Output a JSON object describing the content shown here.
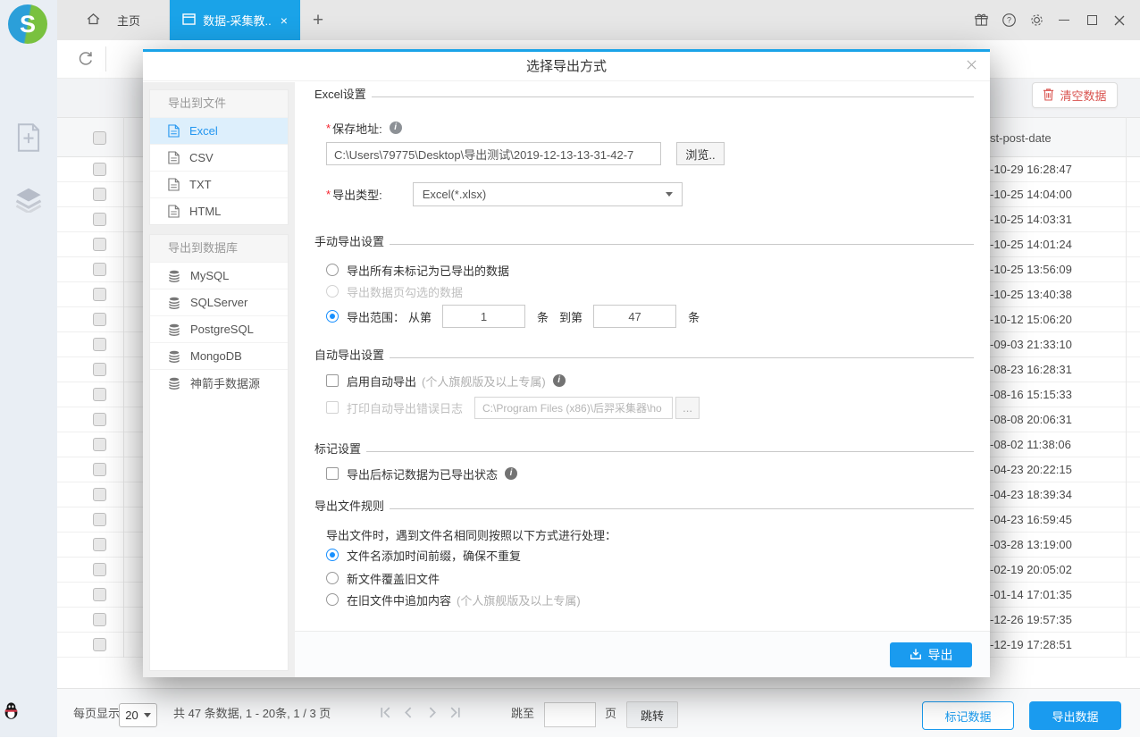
{
  "titlebar": {
    "home_tab_label": "主页",
    "active_tab_label": "数据-采集教..",
    "new_tab_label": "+"
  },
  "table": {
    "clear_button_label": "清空数据",
    "date_column_header": "st-post-date",
    "rows": [
      "-10-29 16:28:47",
      "-10-25 14:04:00",
      "-10-25 14:03:31",
      "-10-25 14:01:24",
      "-10-25 13:56:09",
      "-10-25 13:40:38",
      "-10-12 15:06:20",
      "-09-03 21:33:10",
      "-08-23 16:28:31",
      "-08-16 15:15:33",
      "-08-08 20:06:31",
      "-08-02 11:38:06",
      "-04-23 20:22:15",
      "-04-23 18:39:34",
      "-04-23 16:59:45",
      "-03-28 13:19:00",
      "-02-19 20:05:02",
      "-01-14 17:01:35",
      "-12-26 19:57:35",
      "-12-19 17:28:51"
    ]
  },
  "pagination": {
    "per_page_label": "每页显示:",
    "per_page_value": "20",
    "summary": "共 47 条数据, 1 - 20条, 1 / 3 页",
    "jump_to_label": "跳至",
    "page_unit_label": "页",
    "jump_button_label": "跳转",
    "mark_data_button": "标记数据",
    "export_data_button": "导出数据"
  },
  "dialog": {
    "title": "选择导出方式",
    "sidebar": {
      "file_group_title": "导出到文件",
      "file_items": [
        "Excel",
        "CSV",
        "TXT",
        "HTML"
      ],
      "active_item": "Excel",
      "db_group_title": "导出到数据库",
      "db_items": [
        "MySQL",
        "SQLServer",
        "PostgreSQL",
        "MongoDB",
        "神箭手数据源"
      ]
    },
    "excel_settings": {
      "section_title": "Excel设置",
      "required_mark": "*",
      "save_path_label": "保存地址:",
      "save_path_value": "C:\\Users\\79775\\Desktop\\导出测试\\2019-12-13-13-31-42-7",
      "browse_button_label": "浏览..",
      "export_type_label": "导出类型:",
      "export_type_value": "Excel(*.xlsx)"
    },
    "manual_export": {
      "section_title": "手动导出设置",
      "option_unmarked": "导出所有未标记为已导出的数据",
      "option_checked_page": "导出数据页勾选的数据",
      "range_label": "导出范围：",
      "from_label": "从第",
      "range_from": "1",
      "to_label": "到第",
      "range_to": "47",
      "range_unit": "条"
    },
    "auto_export": {
      "section_title": "自动导出设置",
      "enable_label": "启用自动导出",
      "enable_note": "(个人旗舰版及以上专属)",
      "log_label": "打印自动导出错误日志",
      "log_path_value": "C:\\Program Files (x86)\\后羿采集器\\ho",
      "log_browse_label": "..."
    },
    "mark_settings": {
      "section_title": "标记设置",
      "mark_label": "导出后标记数据为已导出状态"
    },
    "file_rules": {
      "section_title": "导出文件规则",
      "description": "导出文件时，遇到文件名相同则按照以下方式进行处理：",
      "option_time_prefix": "文件名添加时间前缀，确保不重复",
      "option_overwrite": "新文件覆盖旧文件",
      "option_append": "在旧文件中追加内容",
      "option_append_note": "(个人旗舰版及以上专属)"
    },
    "footer": {
      "export_button_label": "导出"
    }
  }
}
